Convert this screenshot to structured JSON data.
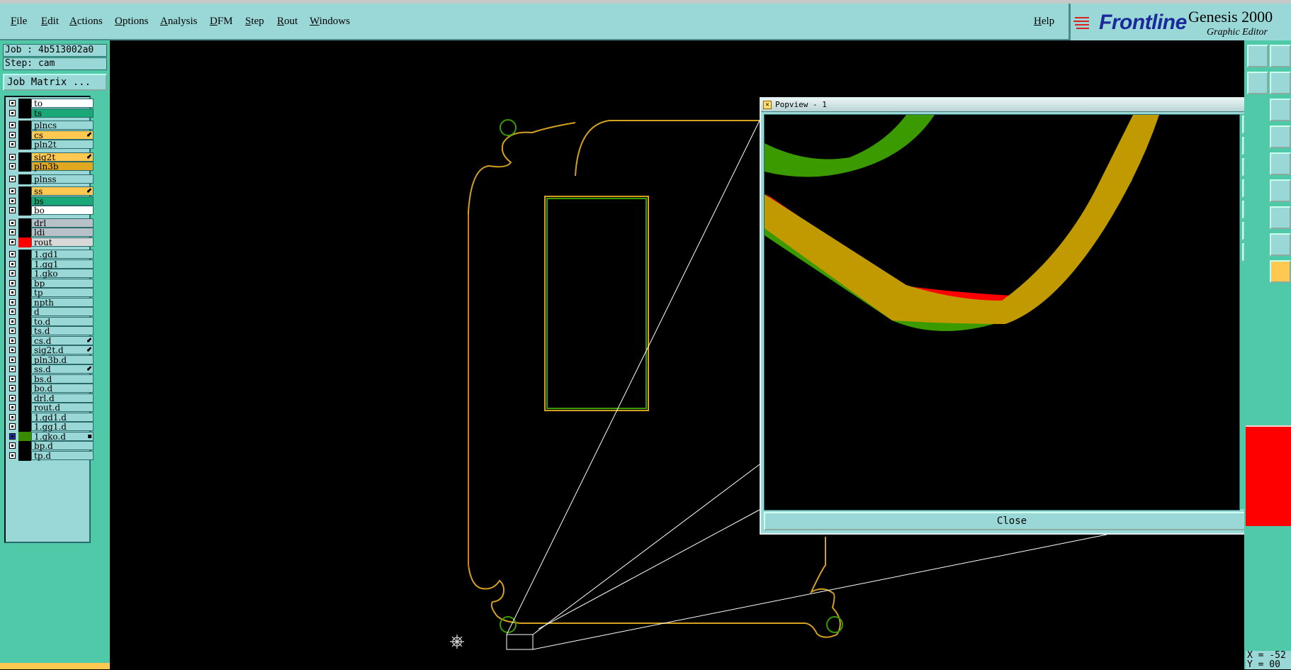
{
  "menu": {
    "items": [
      "File",
      "Edit",
      "Actions",
      "Options",
      "Analysis",
      "DFM",
      "Step",
      "Rout",
      "Windows"
    ],
    "help": "Help"
  },
  "brand": {
    "logo": "Frontline",
    "title": "Genesis 2000",
    "subtitle": "Graphic Editor"
  },
  "job": {
    "job_label": "Job : 4b513002a0",
    "step_label": "Step: cam",
    "matrix_button": "Job Matrix ..."
  },
  "layers": [
    {
      "name": "to",
      "color": "#ffffff"
    },
    {
      "name": "ts",
      "color": "#1aa878"
    },
    {
      "name": "plncs",
      "color": "#9ad8d8"
    },
    {
      "name": "cs",
      "color": "#ffc850",
      "mark": "⬋"
    },
    {
      "name": "pln2t",
      "color": "#9ad8d8"
    },
    {
      "name": "sig2t",
      "color": "#ffc850",
      "mark": "⬋"
    },
    {
      "name": "pln3b",
      "color": "#e0a820"
    },
    {
      "name": "plnss",
      "color": "#9ad8d8"
    },
    {
      "name": "ss",
      "color": "#ffc850",
      "mark": "⬋"
    },
    {
      "name": "bs",
      "color": "#1aa878"
    },
    {
      "name": "bo",
      "color": "#ffffff"
    },
    {
      "name": "drl",
      "color": "#b8c0c8"
    },
    {
      "name": "ldi",
      "color": "#b8c0c8"
    },
    {
      "name": "rout",
      "color": "#d8d8d8",
      "swatch": "#ff0000"
    },
    {
      "name": "1.gd1",
      "color": "#9ad8d8"
    },
    {
      "name": "1.gg1",
      "color": "#9ad8d8"
    },
    {
      "name": "1.gko",
      "color": "#9ad8d8"
    },
    {
      "name": "bp",
      "color": "#9ad8d8"
    },
    {
      "name": "tp",
      "color": "#9ad8d8"
    },
    {
      "name": "npth",
      "color": "#9ad8d8"
    },
    {
      "name": "d",
      "color": "#9ad8d8"
    },
    {
      "name": "to.d",
      "color": "#9ad8d8"
    },
    {
      "name": "ts.d",
      "color": "#9ad8d8"
    },
    {
      "name": "cs.d",
      "color": "#9ad8d8",
      "mark": "⬋"
    },
    {
      "name": "sig2t.d",
      "color": "#9ad8d8",
      "mark": "⬋"
    },
    {
      "name": "pln3b.d",
      "color": "#9ad8d8"
    },
    {
      "name": "ss.d",
      "color": "#9ad8d8",
      "mark": "⬋"
    },
    {
      "name": "bs.d",
      "color": "#9ad8d8"
    },
    {
      "name": "bo.d",
      "color": "#9ad8d8"
    },
    {
      "name": "drl.d",
      "color": "#9ad8d8"
    },
    {
      "name": "rout.d",
      "color": "#9ad8d8"
    },
    {
      "name": "1.gd1.d",
      "color": "#9ad8d8"
    },
    {
      "name": "1.gg1.d",
      "color": "#9ad8d8"
    },
    {
      "name": "1.gko.d",
      "color": "#9ad8d8",
      "swatch": "#3a8a00",
      "selected": true,
      "mark": "▪"
    },
    {
      "name": "bp.d",
      "color": "#9ad8d8"
    },
    {
      "name": "tp.d",
      "color": "#9ad8d8"
    }
  ],
  "popview": {
    "title": "Popview - 1",
    "close_label": "Close"
  },
  "coord": {
    "x": "X = -52",
    "y": "Y = 00"
  },
  "colors": {
    "panel": "#4fc9a8",
    "widget": "#9ad8d8",
    "profile": "#d4a020",
    "drill": "#3a9a00",
    "rout": "#ff0000"
  }
}
